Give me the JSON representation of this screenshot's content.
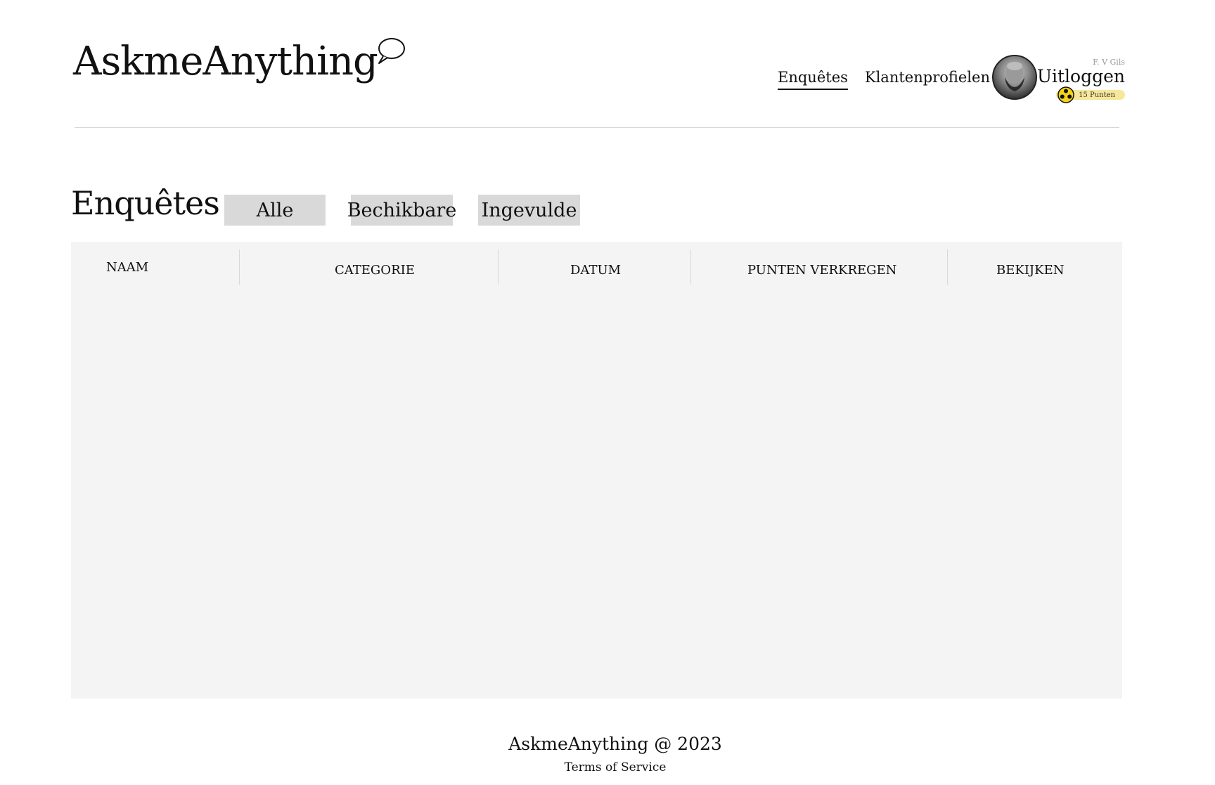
{
  "header": {
    "logo": "AskmeAnything",
    "nav": [
      {
        "label": "Enquêtes",
        "active": true
      },
      {
        "label": "Klantenprofielen",
        "active": false
      }
    ],
    "user": {
      "name": "F. V Gils",
      "logout_label": "Uitloggen",
      "points_label": "15 Punten"
    }
  },
  "main": {
    "title": "Enquêtes",
    "filters": [
      "Alle",
      "Bechikbare",
      "Ingevulde"
    ],
    "table": {
      "columns": [
        "NAAM",
        "CATEGORIE",
        "DATUM",
        "PUNTEN VERKREGEN",
        "BEKIJKEN"
      ],
      "rows": []
    }
  },
  "footer": {
    "copyright": "AskmeAnything @ 2023",
    "terms": "Terms of Service"
  },
  "colors": {
    "points_badge": "#f7e79a",
    "coin": "#f5d31b",
    "table_bg": "#f4f4f4",
    "filter_bg": "#d9d9d9"
  },
  "icons": [
    "speech-bubble-icon",
    "avatar",
    "coin-icon"
  ]
}
